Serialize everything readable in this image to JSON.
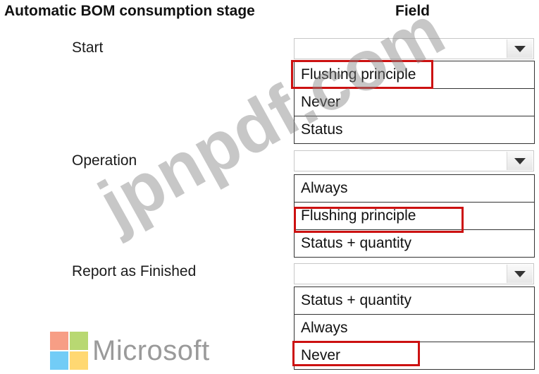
{
  "headers": {
    "stage": "Automatic BOM consumption stage",
    "field": "Field"
  },
  "rows": [
    {
      "label": "Start",
      "dropdown_value": "",
      "options": [
        "Flushing principle",
        "Never",
        "Status"
      ],
      "highlighted_option": "Flushing principle"
    },
    {
      "label": "Operation",
      "dropdown_value": "",
      "options": [
        "Always",
        "Flushing principle",
        "Status + quantity"
      ],
      "highlighted_option": "Flushing principle"
    },
    {
      "label": "Report as Finished",
      "dropdown_value": "",
      "options": [
        "Status + quantity",
        "Always",
        "Never"
      ],
      "highlighted_option": "Never"
    }
  ],
  "logo": {
    "name": "Microsoft",
    "colors": [
      "#f25022",
      "#7fba00",
      "#00a4ef",
      "#ffb900"
    ]
  },
  "watermark": "jpnpdf.com",
  "colors": {
    "highlight": "#cc1111"
  }
}
